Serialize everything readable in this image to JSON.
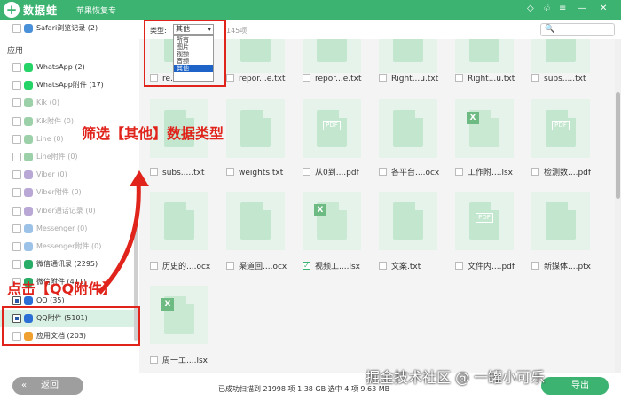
{
  "app": {
    "name": "数据蛙",
    "subtitle": "苹果恢复专",
    "logo": "+"
  },
  "titlebar_icons": [
    "diamond-icon",
    "shirt-icon",
    "menu-icon",
    "minimize-icon",
    "close-icon"
  ],
  "titlebar_glyphs": {
    "diamond": "◇",
    "shirt": "♧",
    "menu": "≡",
    "minimize": "—",
    "close": "✕"
  },
  "sidebar": {
    "top_item": "Safari浏览记录 (2)",
    "section": "应用",
    "items": [
      {
        "label": "WhatsApp (2)",
        "dim": false,
        "color": "#25d366"
      },
      {
        "label": "WhatsApp附件 (17)",
        "dim": false,
        "color": "#25d366"
      },
      {
        "label": "Kik (0)",
        "dim": true,
        "color": "#9bd0a8"
      },
      {
        "label": "Kik附件 (0)",
        "dim": true,
        "color": "#9bd0a8"
      },
      {
        "label": "Line (0)",
        "dim": true,
        "color": "#9bd0a8"
      },
      {
        "label": "Line附件 (0)",
        "dim": true,
        "color": "#9bd0a8"
      },
      {
        "label": "Viber (0)",
        "dim": true,
        "color": "#b9a8d6"
      },
      {
        "label": "Viber附件 (0)",
        "dim": true,
        "color": "#b9a8d6"
      },
      {
        "label": "Viber通话记录 (0)",
        "dim": true,
        "color": "#b9a8d6"
      },
      {
        "label": "Messenger (0)",
        "dim": true,
        "color": "#9cc2e8"
      },
      {
        "label": "Messenger附件 (0)",
        "dim": true,
        "color": "#9cc2e8"
      },
      {
        "label": "微信通讯录 (2295)",
        "dim": false,
        "color": "#2aae67"
      },
      {
        "label": "微信附件 (411)",
        "dim": false,
        "color": "#2aae67"
      },
      {
        "label": "QQ (35)",
        "dim": false,
        "color": "#2b6fd6",
        "checked": true
      },
      {
        "label": "QQ附件 (5101)",
        "dim": false,
        "color": "#2b6fd6",
        "checked": true,
        "selected": true
      },
      {
        "label": "应用文档 (203)",
        "dim": false,
        "color": "#f0a030"
      }
    ]
  },
  "toolbar": {
    "type_label": "类型:",
    "type_value": "其他",
    "type_options": [
      "所有",
      "图片",
      "视频",
      "音频",
      "其他"
    ],
    "count_text": "145项",
    "search_icon": "🔍"
  },
  "files": [
    {
      "name": "re...u.txt",
      "kind": "txt",
      "checked": false
    },
    {
      "name": "repor...e.txt",
      "kind": "txt",
      "checked": false
    },
    {
      "name": "repor...e.txt",
      "kind": "txt",
      "checked": false
    },
    {
      "name": "Right...u.txt",
      "kind": "txt",
      "checked": false
    },
    {
      "name": "Right...u.txt",
      "kind": "txt",
      "checked": false
    },
    {
      "name": "subs.....txt",
      "kind": "txt",
      "checked": false
    },
    {
      "name": "subs.....txt",
      "kind": "txt",
      "checked": false
    },
    {
      "name": "weights.txt",
      "kind": "txt",
      "checked": false
    },
    {
      "name": "从0到....pdf",
      "kind": "pdf",
      "checked": false
    },
    {
      "name": "各平台....ocx",
      "kind": "doc",
      "checked": false
    },
    {
      "name": "工作附....lsx",
      "kind": "xls",
      "checked": false
    },
    {
      "name": "检测数....pdf",
      "kind": "pdf",
      "checked": false
    },
    {
      "name": "历史的....ocx",
      "kind": "doc",
      "checked": false
    },
    {
      "name": "渠道回....ocx",
      "kind": "doc",
      "checked": false
    },
    {
      "name": "视频工....lsx",
      "kind": "xls",
      "checked": true
    },
    {
      "name": "文案.txt",
      "kind": "txt",
      "checked": false
    },
    {
      "name": "文件内....pdf",
      "kind": "pdf",
      "checked": false
    },
    {
      "name": "新媒体....ptx",
      "kind": "ppt",
      "checked": false
    },
    {
      "name": "周一工....lsx",
      "kind": "xls",
      "checked": false
    }
  ],
  "badges": {
    "pdf": "PDF",
    "xls": "X"
  },
  "bottom": {
    "back_label": "返回",
    "back_icon": "«",
    "status": "已成功扫描到 21998 项 1.38 GB  选中 4 项 9.63 MB",
    "export_label": "导出"
  },
  "annotations": {
    "filter_hint": "筛选【其他】数据类型",
    "click_hint": "点击【QQ附件】",
    "watermark": "掘金技术社区 @ 一罐小可乐",
    "accent": "#e0241c"
  },
  "colors": {
    "brand": "#3cb371",
    "selection": "#1e64c8"
  }
}
